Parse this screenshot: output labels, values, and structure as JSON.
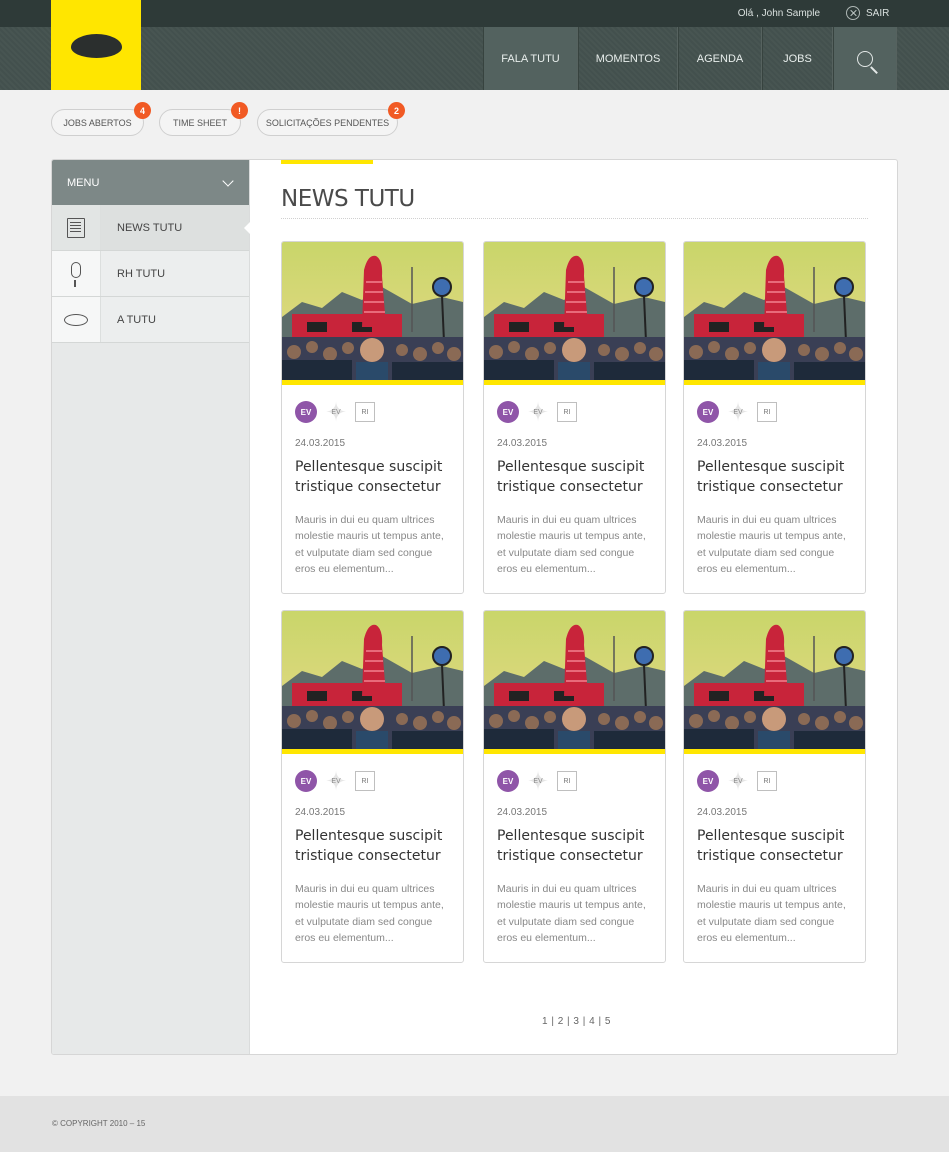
{
  "topbar": {
    "greeting": "Olá , John Sample",
    "logout_label": "SAIR"
  },
  "nav": {
    "items": [
      "FALA TUTU",
      "MOMENTOS",
      "AGENDA",
      "JOBS"
    ]
  },
  "pills": [
    {
      "label": "JOBS ABERTOS",
      "badge": "4"
    },
    {
      "label": "TIME SHEET",
      "badge": "!"
    },
    {
      "label": "SOLICITAÇÕES PENDENTES",
      "badge": "2"
    }
  ],
  "sidebar": {
    "header": "MENU",
    "items": [
      {
        "label": "NEWS TUTU",
        "icon": "newspaper-icon"
      },
      {
        "label": "RH TUTU",
        "icon": "microphone-icon"
      },
      {
        "label": "A TUTU",
        "icon": "bean-icon"
      }
    ]
  },
  "main": {
    "title": "NEWS TUTU",
    "cards": [
      {
        "tags": [
          "EV",
          "EV",
          "RI"
        ],
        "date": "24.03.2015",
        "title": "Pellentesque suscipit tristique consectetur",
        "text": "Mauris in dui eu quam ultrices molestie mauris ut tempus ante, et vulputate diam sed congue eros eu elementum..."
      },
      {
        "tags": [
          "EV",
          "EV",
          "RI"
        ],
        "date": "24.03.2015",
        "title": "Pellentesque suscipit tristique consectetur",
        "text": "Mauris in dui eu quam ultrices molestie mauris ut tempus ante, et vulputate diam sed congue eros eu elementum..."
      },
      {
        "tags": [
          "EV",
          "EV",
          "RI"
        ],
        "date": "24.03.2015",
        "title": "Pellentesque suscipit tristique consectetur",
        "text": "Mauris in dui eu quam ultrices molestie mauris ut tempus ante, et vulputate diam sed congue eros eu elementum..."
      },
      {
        "tags": [
          "EV",
          "EV",
          "RI"
        ],
        "date": "24.03.2015",
        "title": "Pellentesque suscipit tristique consectetur",
        "text": "Mauris in dui eu quam ultrices molestie mauris ut tempus ante, et vulputate diam sed congue eros eu elementum..."
      },
      {
        "tags": [
          "EV",
          "EV",
          "RI"
        ],
        "date": "24.03.2015",
        "title": "Pellentesque suscipit tristique consectetur",
        "text": "Mauris in dui eu quam ultrices molestie mauris ut tempus ante, et vulputate diam sed congue eros eu elementum..."
      },
      {
        "tags": [
          "EV",
          "EV",
          "RI"
        ],
        "date": "24.03.2015",
        "title": "Pellentesque suscipit tristique consectetur",
        "text": "Mauris in dui eu quam ultrices molestie mauris ut tempus ante, et vulputate diam sed congue eros eu elementum..."
      }
    ],
    "pagination": "1 | 2 | 3 | 4 | 5"
  },
  "footer": {
    "copyright": "© COPYRIGHT 2010 – 15"
  },
  "colors": {
    "accent": "#ffe600",
    "header": "#44524f",
    "topbar": "#2e3a38",
    "badge": "#f15a24",
    "tag": "#8f55a8"
  }
}
